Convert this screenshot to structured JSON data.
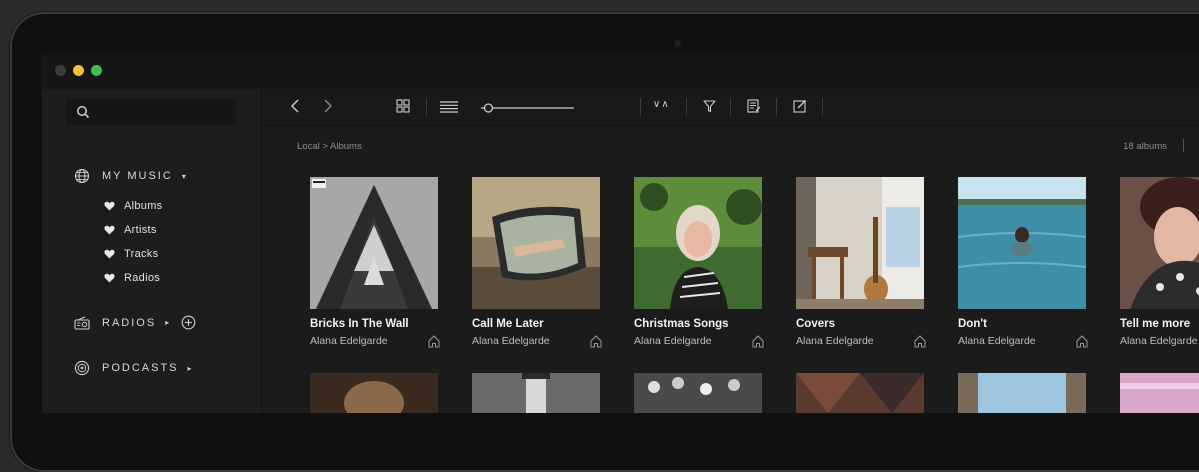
{
  "window": {
    "controls": [
      "close",
      "minimize",
      "maximize"
    ]
  },
  "sidebar": {
    "search": {
      "placeholder": ""
    },
    "sections": [
      {
        "label": "MY MUSIC",
        "icon": "globe-icon",
        "caret": "▾"
      },
      {
        "label": "RADIOS",
        "icon": "radio-icon",
        "caret": "▸"
      },
      {
        "label": "PODCASTS",
        "icon": "podcast-icon",
        "caret": "▸"
      }
    ],
    "my_music_items": [
      "Albums",
      "Artists",
      "Tracks",
      "Radios"
    ]
  },
  "toolbar": {
    "sort_label": "∨∧",
    "icons": [
      "back-icon",
      "forward-icon",
      "grid-view-icon",
      "list-view-icon",
      "zoom-slider",
      "sort-icon",
      "filter-icon",
      "edit-list-icon",
      "edit-icon"
    ],
    "zoom_level": 0.08
  },
  "breadcrumb": "Local > Albums",
  "album_count": "18 albums",
  "albums": [
    {
      "title": "Bricks In The Wall",
      "artist": "Alana Edelgarde"
    },
    {
      "title": "Call Me Later",
      "artist": "Alana Edelgarde"
    },
    {
      "title": "Christmas Songs",
      "artist": "Alana Edelgarde"
    },
    {
      "title": "Covers",
      "artist": "Alana Edelgarde"
    },
    {
      "title": "Don't",
      "artist": "Alana Edelgarde"
    },
    {
      "title": "Tell me more",
      "artist": "Alana Edelgarde"
    }
  ],
  "colors": {
    "accent_yellow": "#f2c137",
    "accent_green": "#3ec04d",
    "background": "#1b1b1b"
  }
}
